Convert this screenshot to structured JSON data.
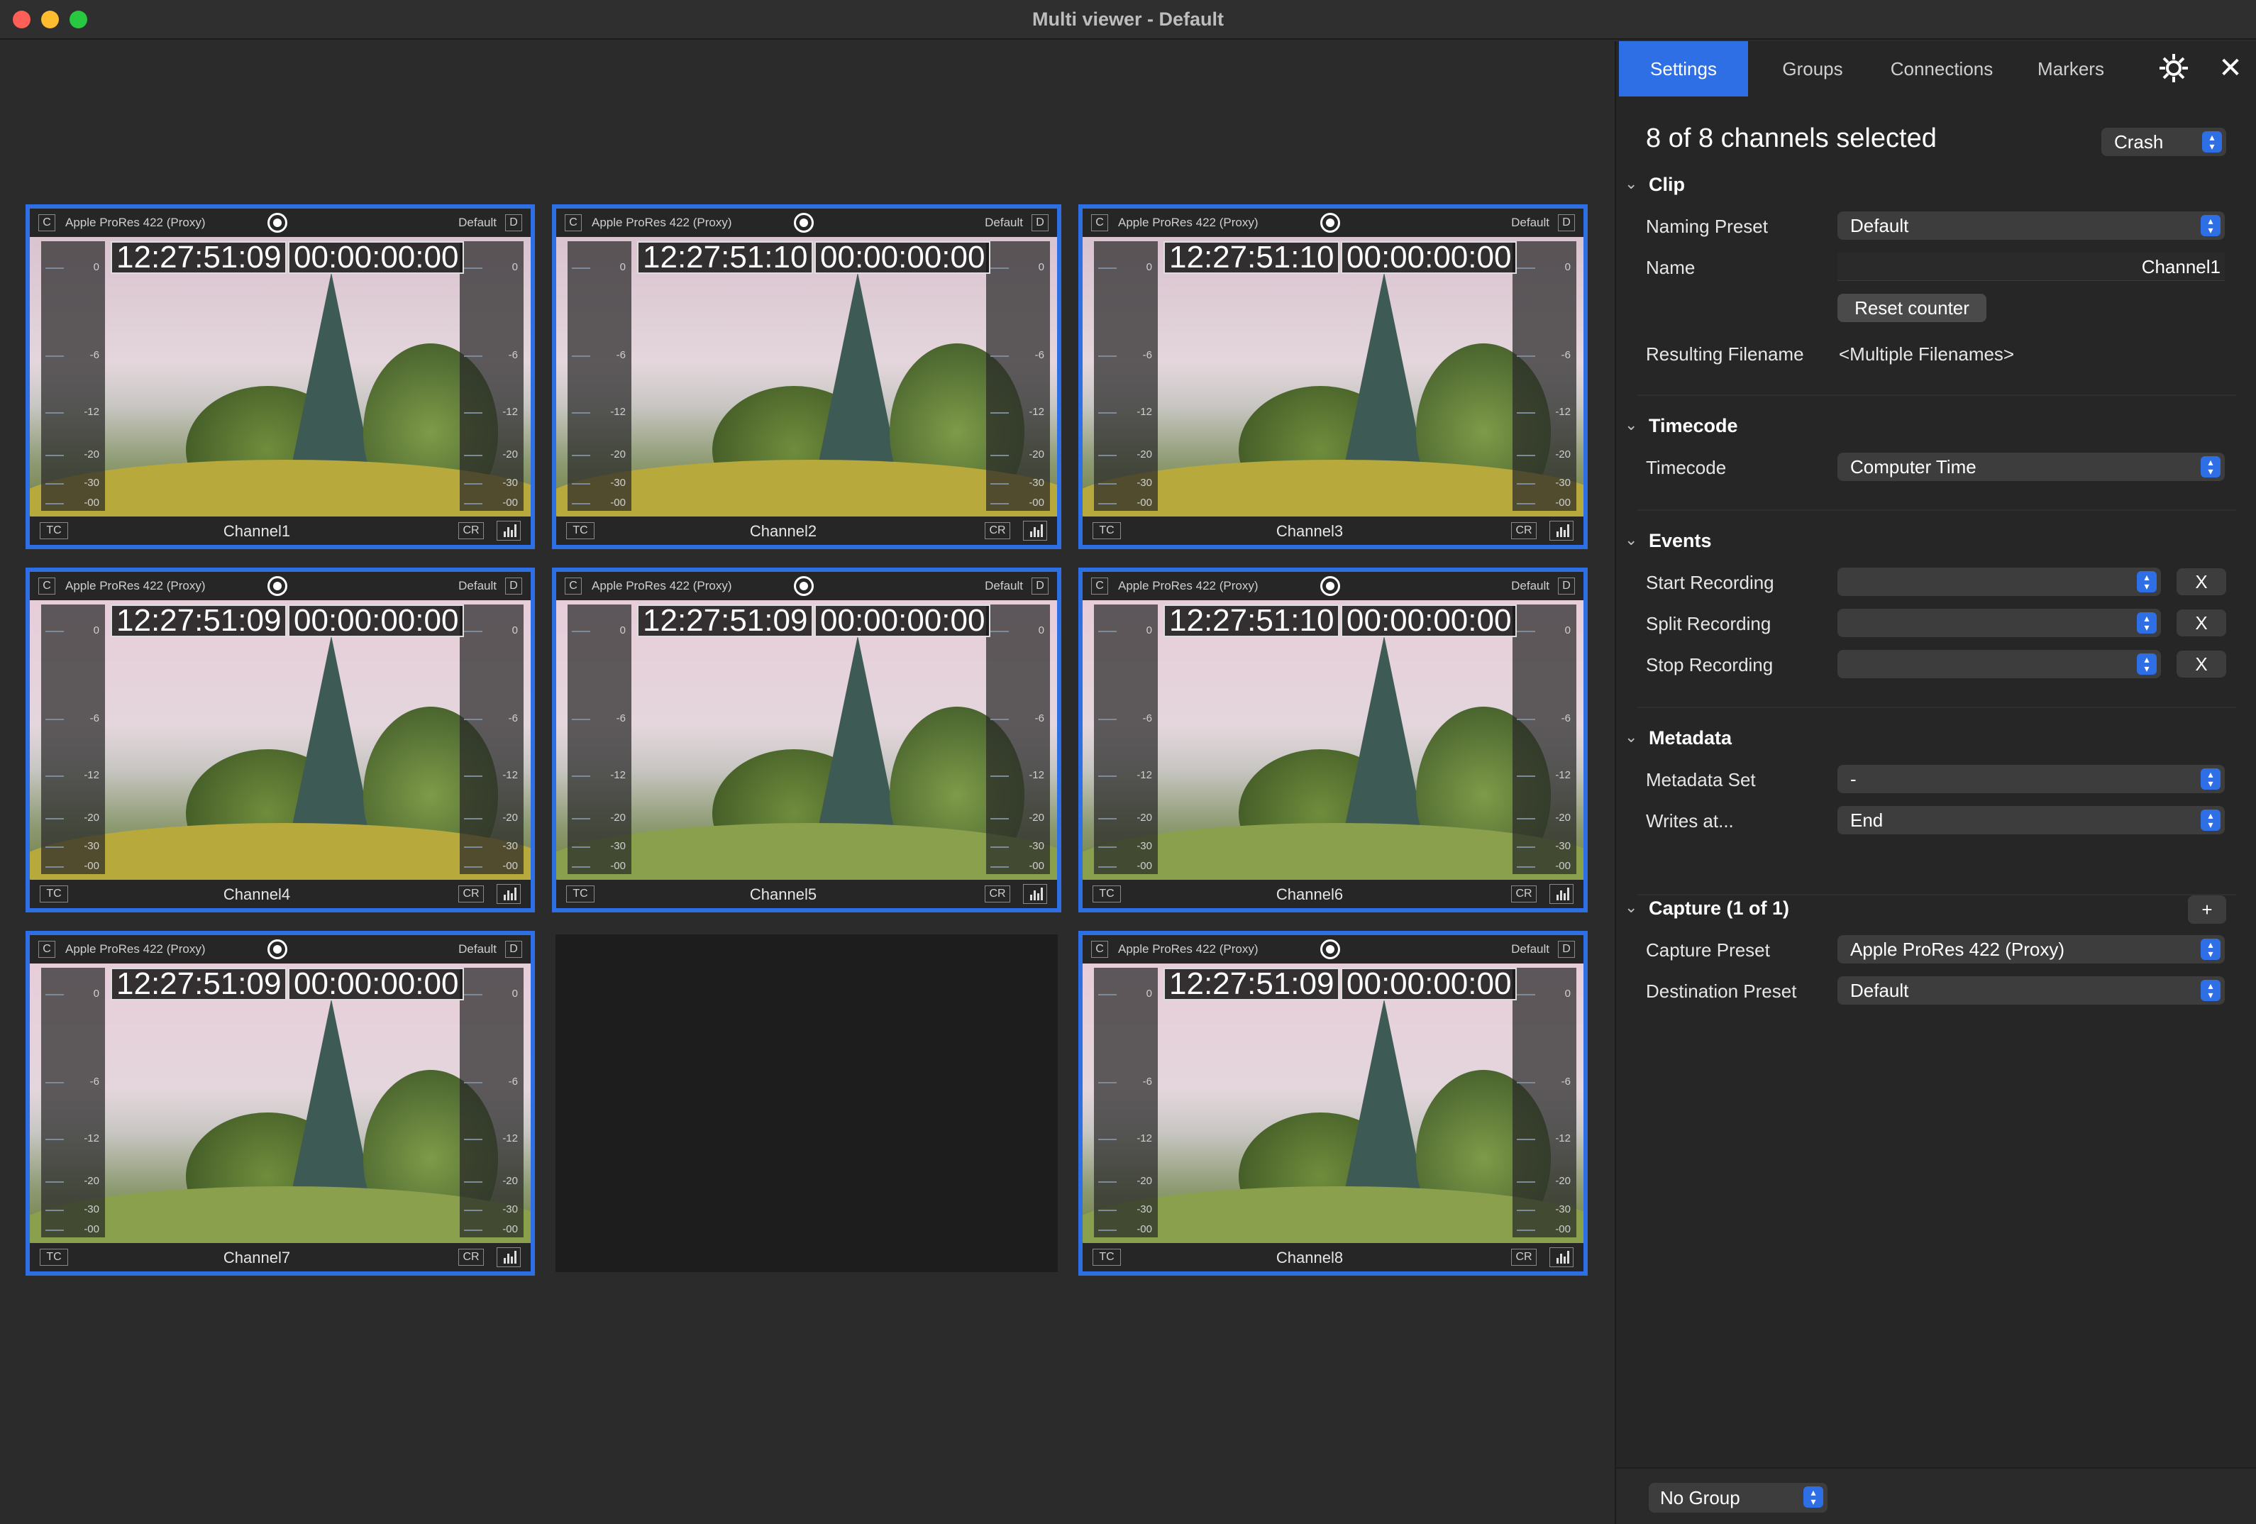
{
  "window": {
    "title": "Multi viewer - Default"
  },
  "channels": [
    {
      "name": "Channel1",
      "codec": "Apple ProRes 422 (Proxy)",
      "preset": "Default",
      "timecode": "12:27:51:09",
      "duration": "00:00:00:00"
    },
    {
      "name": "Channel2",
      "codec": "Apple ProRes 422 (Proxy)",
      "preset": "Default",
      "timecode": "12:27:51:10",
      "duration": "00:00:00:00"
    },
    {
      "name": "Channel3",
      "codec": "Apple ProRes 422 (Proxy)",
      "preset": "Default",
      "timecode": "12:27:51:10",
      "duration": "00:00:00:00"
    },
    {
      "name": "Channel4",
      "codec": "Apple ProRes 422 (Proxy)",
      "preset": "Default",
      "timecode": "12:27:51:09",
      "duration": "00:00:00:00"
    },
    {
      "name": "Channel5",
      "codec": "Apple ProRes 422 (Proxy)",
      "preset": "Default",
      "timecode": "12:27:51:09",
      "duration": "00:00:00:00"
    },
    {
      "name": "Channel6",
      "codec": "Apple ProRes 422 (Proxy)",
      "preset": "Default",
      "timecode": "12:27:51:10",
      "duration": "00:00:00:00"
    },
    {
      "name": "Channel7",
      "codec": "Apple ProRes 422 (Proxy)",
      "preset": "Default",
      "timecode": "12:27:51:09",
      "duration": "00:00:00:00"
    },
    {
      "name": "Channel8",
      "codec": "Apple ProRes 422 (Proxy)",
      "preset": "Default",
      "timecode": "12:27:51:09",
      "duration": "00:00:00:00"
    }
  ],
  "tile_labels": {
    "c": "C",
    "d": "D",
    "tc": "TC",
    "cr": "CR"
  },
  "vu_scale": [
    "0",
    "-6",
    "-12",
    "-20",
    "-30",
    "-00"
  ],
  "panel": {
    "tabs": [
      "Settings",
      "Groups",
      "Connections",
      "Markers"
    ],
    "selection": "8 of 8 channels selected",
    "mode": "Crash",
    "clip": {
      "title": "Clip",
      "naming_preset_label": "Naming Preset",
      "naming_preset": "Default",
      "name_label": "Name",
      "name_value": "Channel1",
      "reset_counter": "Reset counter",
      "resulting_filename_label": "Resulting Filename",
      "resulting_filename": "<Multiple Filenames>"
    },
    "timecode": {
      "title": "Timecode",
      "label": "Timecode",
      "value": "Computer Time"
    },
    "events": {
      "title": "Events",
      "start_label": "Start Recording",
      "split_label": "Split Recording",
      "stop_label": "Stop Recording",
      "clear": "X"
    },
    "metadata": {
      "title": "Metadata",
      "set_label": "Metadata Set",
      "set_value": "-",
      "writes_label": "Writes at...",
      "writes_value": "End"
    },
    "capture": {
      "title": "Capture (1 of 1)",
      "add": "+",
      "preset_label": "Capture Preset",
      "preset_value": "Apple ProRes 422 (Proxy)",
      "destination_label": "Destination Preset",
      "destination_value": "Default"
    },
    "footer": {
      "group": "No Group"
    }
  },
  "colors": {
    "accent": "#2f6fe6",
    "background": "#2b2b2b",
    "panel": "#262626"
  }
}
